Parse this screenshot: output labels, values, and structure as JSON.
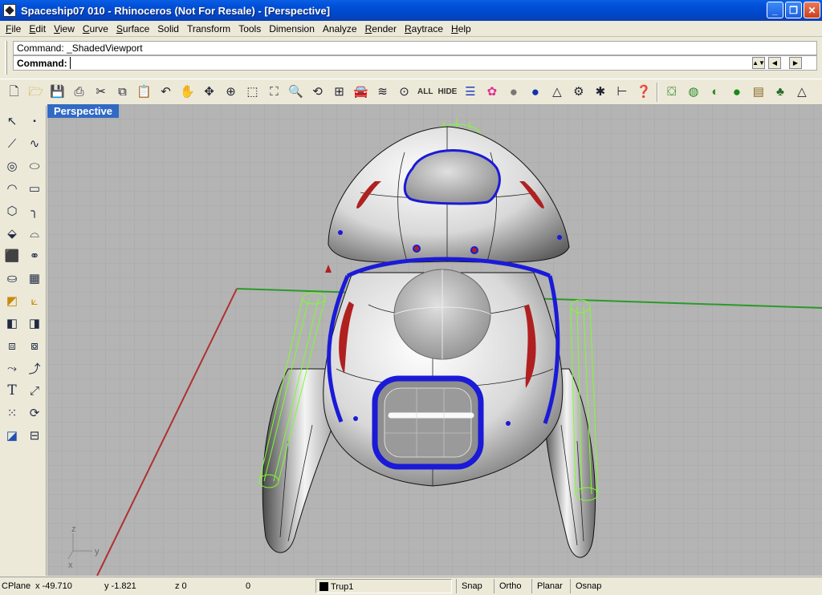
{
  "window": {
    "title": "Spaceship07 010 - Rhinoceros (Not For Resale) - [Perspective]",
    "controls": [
      "minimize",
      "maximize",
      "close"
    ]
  },
  "menu": [
    {
      "u": "F",
      "rest": "ile"
    },
    {
      "u": "E",
      "rest": "dit"
    },
    {
      "u": "V",
      "rest": "iew"
    },
    {
      "u": "C",
      "rest": "urve"
    },
    {
      "u": "S",
      "rest": "urface"
    },
    {
      "u": "",
      "rest": "Solid"
    },
    {
      "u": "",
      "rest": "Transform"
    },
    {
      "u": "",
      "rest": "Tools"
    },
    {
      "u": "",
      "rest": "Dimension"
    },
    {
      "u": "",
      "rest": "Analyze"
    },
    {
      "u": "R",
      "rest": "ender"
    },
    {
      "u": "R",
      "rest": "aytrace"
    },
    {
      "u": "H",
      "rest": "elp"
    }
  ],
  "command": {
    "history": "Command: _ShadedViewport",
    "prompt": "Command:",
    "value": ""
  },
  "toolbar_labels": {
    "all": "ALL",
    "hide": "HIDE"
  },
  "viewport": {
    "name": "Perspective",
    "axis_z": "z",
    "axis_y": "y",
    "axis_x": "x"
  },
  "status": {
    "cplane": "CPlane",
    "x": "x -49.710",
    "y": "y -1.821",
    "z": "z 0",
    "extra": "0",
    "layer": "Trup1",
    "snap": "Snap",
    "ortho": "Ortho",
    "planar": "Planar",
    "osnap": "Osnap"
  },
  "colors": {
    "title_blue": "#0050d8",
    "viewport_bg": "#b4b4b4",
    "selection_blue": "#1a1ad8",
    "accent_red": "#b02020",
    "wire_green": "#7cff2a"
  }
}
